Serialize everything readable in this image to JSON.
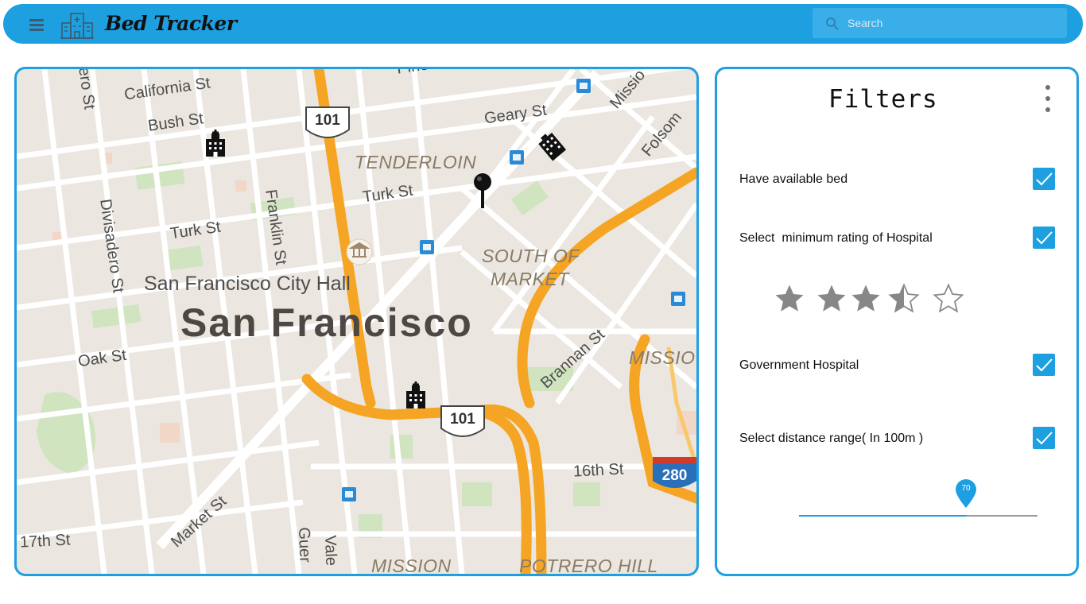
{
  "app": {
    "title": "Bed Tracker",
    "search_placeholder": "Search",
    "accent_color": "#1e9fe0"
  },
  "map": {
    "street_labels": {
      "california": "California St",
      "bush": "Bush St",
      "geary": "Geary St",
      "turk_left": "Turk St",
      "turk_right": "Turk St",
      "franklin": "Franklin St",
      "divisadero": "Divisadero St",
      "oak": "Oak St",
      "market": "Market St",
      "brannan": "Brannan St",
      "sixteenth": "16th St",
      "seventeenth": "17th St",
      "folsom": "Folsom",
      "mission_st": "Missio",
      "guerrero": "Guer",
      "valencia": "Vale",
      "fillmore": "ero St",
      "pine": "Pine"
    },
    "districts": {
      "tenderloin": "TENDERLOIN",
      "south_of_market_1": "SOUTH OF",
      "south_of_market_2": "MARKET",
      "mission_district": "MISSIO",
      "mission": "MISSION",
      "potrero": "POTRERO HILL"
    },
    "landmark": "San Francisco City Hall",
    "city": "San Francisco",
    "highway_shields": [
      "101",
      "101",
      "280"
    ],
    "markers": [
      "hospital-icon",
      "hospital-icon",
      "map-pin-icon",
      "building-icon"
    ]
  },
  "filters": {
    "title": "Filters",
    "rows": [
      {
        "label": "Have available bed",
        "checked": true
      },
      {
        "label": "Select  minimum rating of Hospital",
        "checked": true
      },
      {
        "label": "Government Hospital",
        "checked": true
      },
      {
        "label": "Select distance range( In 100m )",
        "checked": true
      }
    ],
    "rating": {
      "value": 3.5,
      "max": 5
    },
    "distance": {
      "value": 70,
      "min": 0,
      "max": 100,
      "value_label": "70"
    }
  }
}
